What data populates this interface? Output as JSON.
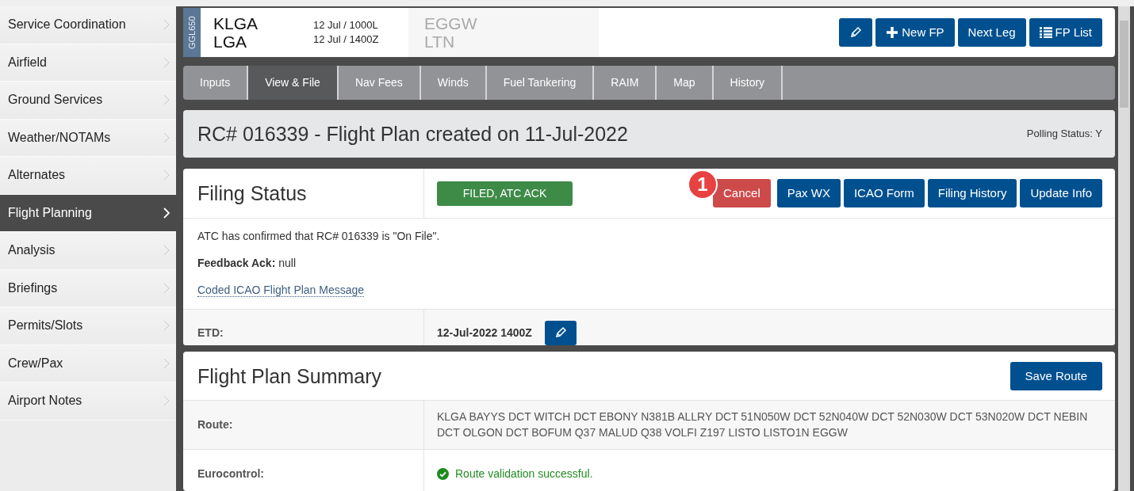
{
  "sidebar": {
    "items": [
      {
        "label": "Service Coordination",
        "selected": false
      },
      {
        "label": "Airfield",
        "selected": false
      },
      {
        "label": "Ground Services",
        "selected": false
      },
      {
        "label": "Weather/NOTAMs",
        "selected": false
      },
      {
        "label": "Alternates",
        "selected": false
      },
      {
        "label": "Flight Planning",
        "selected": true
      },
      {
        "label": "Analysis",
        "selected": false
      },
      {
        "label": "Briefings",
        "selected": false
      },
      {
        "label": "Permits/Slots",
        "selected": false
      },
      {
        "label": "Crew/Pax",
        "selected": false
      },
      {
        "label": "Airport Notes",
        "selected": false
      }
    ]
  },
  "header": {
    "aircraft": "GGL650",
    "origin": {
      "icao": "KLGA",
      "iata": "LGA"
    },
    "times": [
      "12 Jul / 1000L",
      "12 Jul / 1400Z"
    ],
    "destination": {
      "icao": "EGGW",
      "iata": "LTN"
    },
    "buttons": [
      {
        "kind": "edit"
      },
      {
        "kind": "plus",
        "label": "New FP"
      },
      {
        "kind": "text",
        "label": "Next Leg"
      },
      {
        "kind": "list",
        "label": "FP List"
      }
    ]
  },
  "tabs": [
    {
      "label": "Inputs",
      "selected": false
    },
    {
      "label": "View & File",
      "selected": true
    },
    {
      "label": "Nav Fees",
      "selected": false
    },
    {
      "label": "Winds",
      "selected": false
    },
    {
      "label": "Fuel Tankering",
      "selected": false
    },
    {
      "label": "RAIM",
      "selected": false
    },
    {
      "label": "Map",
      "selected": false
    },
    {
      "label": "History",
      "selected": false
    }
  ],
  "plan_title": "RC# 016339 - Flight Plan created on 11-Jul-2022",
  "polling_status": "Polling Status: Y",
  "filing_status": {
    "title": "Filing Status",
    "status": {
      "label": "FILED, ATC ACK",
      "color": "#3d8b47"
    },
    "annotation": "1",
    "buttons": [
      {
        "label": "Cancel",
        "kind": "danger"
      },
      {
        "label": "Pax WX",
        "kind": "primary"
      },
      {
        "label": "ICAO Form",
        "kind": "primary"
      },
      {
        "label": "Filing History",
        "kind": "primary"
      },
      {
        "label": "Update Info",
        "kind": "primary"
      }
    ],
    "message": "ATC has confirmed that RC# 016339 is \"On File\".",
    "feedback": "**Feedback Ack:** null",
    "link": "Coded ICAO Flight Plan Message",
    "etd": {
      "label": "ETD:",
      "value": "12-Jul-2022 1400Z"
    }
  },
  "summary": {
    "title": "Flight Plan Summary",
    "button": "Save Route",
    "rows": [
      {
        "label": "Route:",
        "kind": "text",
        "value": "KLGA BAYYS DCT WITCH DCT EBONY N381B ALLRY DCT 51N050W DCT 52N040W DCT 52N030W DCT 53N020W DCT NEBIN DCT OLGON DCT BOFUM Q37 MALUD Q38 VOLFI Z197 LISTO LISTO1N EGGW"
      },
      {
        "label": "Eurocontrol:",
        "kind": "valid",
        "value": "Route validation successful."
      }
    ]
  }
}
